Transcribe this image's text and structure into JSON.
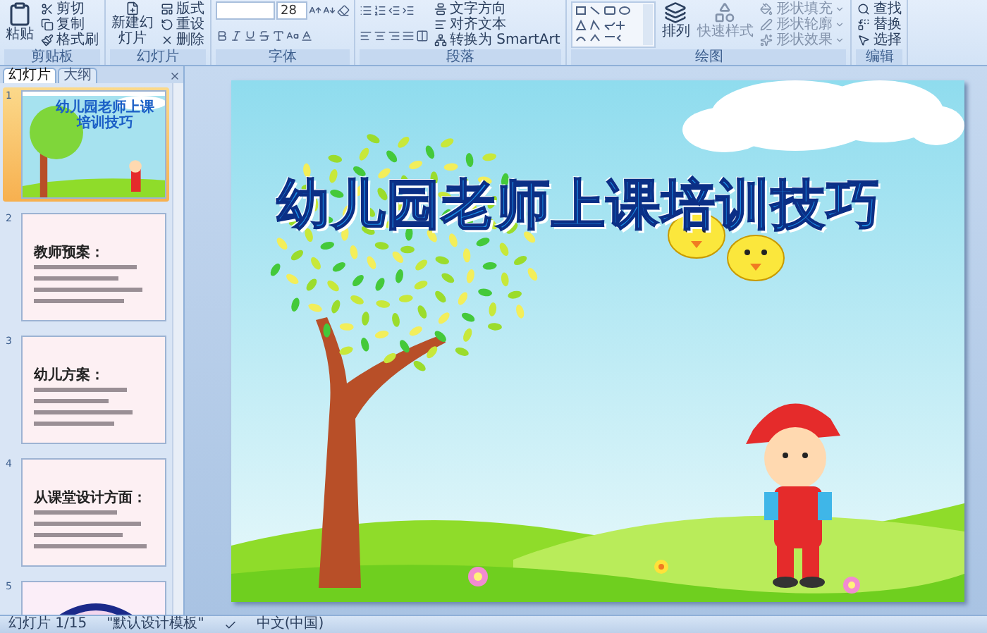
{
  "ribbon": {
    "groups": [
      {
        "kind": "clipboard",
        "label": "剪贴板",
        "paste": "粘贴",
        "items": [
          "剪切",
          "复制",
          "格式刷"
        ]
      },
      {
        "kind": "slides",
        "label": "幻灯片",
        "new_slide": "新建幻灯片",
        "items": [
          "版式",
          "重设",
          "删除"
        ]
      },
      {
        "kind": "font",
        "label": "字体",
        "font_size": "28"
      },
      {
        "kind": "paragraph",
        "label": "段落",
        "items": [
          "文字方向",
          "对齐文本",
          "转换为 SmartArt"
        ]
      },
      {
        "kind": "drawing",
        "label": "绘图",
        "arrange": "排列",
        "quick_styles": "快速样式",
        "items": [
          "形状填充",
          "形状轮廓",
          "形状效果"
        ]
      },
      {
        "kind": "editing",
        "label": "编辑",
        "items": [
          "查找",
          "替换",
          "选择"
        ]
      }
    ]
  },
  "panel_tabs": [
    {
      "label": "幻灯片",
      "selected": true
    },
    {
      "label": "大纲",
      "selected": false
    }
  ],
  "slides": [
    {
      "number": "1",
      "kind": "title",
      "selected": true,
      "title": "幼儿园老师上课培训技巧"
    },
    {
      "number": "2",
      "kind": "text",
      "selected": false,
      "heading": "教师预案："
    },
    {
      "number": "3",
      "kind": "text",
      "selected": false,
      "heading": "幼儿方案："
    },
    {
      "number": "4",
      "kind": "text",
      "selected": false,
      "heading": "从课堂设计方面："
    },
    {
      "number": "5",
      "kind": "decor",
      "selected": false
    }
  ],
  "slide": {
    "title": "幼儿园老师上课培训技巧"
  },
  "status_bar": {
    "slide_position": "幻灯片 1/15",
    "theme": "\"默认设计模板\"",
    "language": "中文(中国)"
  }
}
